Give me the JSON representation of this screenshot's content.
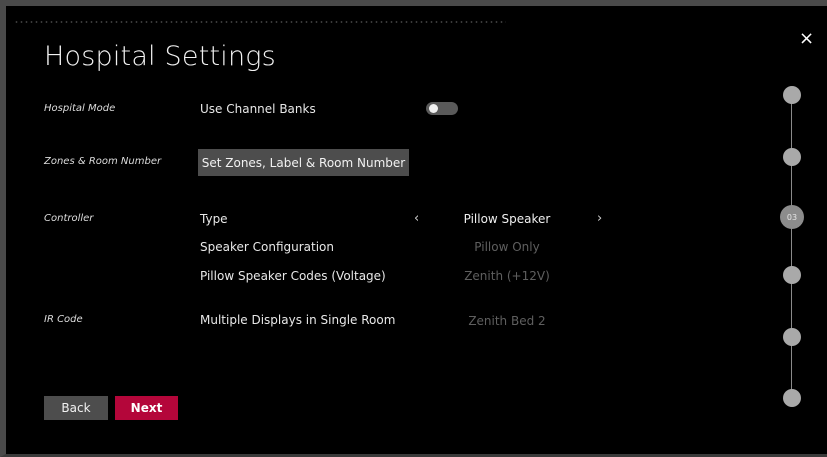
{
  "page": {
    "title": "Hospital Settings",
    "close_glyph": "×"
  },
  "sections": {
    "hospital_mode": {
      "label": "Hospital Mode",
      "use_channel_banks_label": "Use Channel Banks",
      "use_channel_banks_on": false
    },
    "zones": {
      "label": "Zones & Room Number",
      "button_label": "Set Zones, Label & Room Number"
    },
    "controller": {
      "label": "Controller",
      "type_label": "Type",
      "type_value": "Pillow Speaker",
      "prev_glyph": "‹",
      "next_glyph": "›",
      "speaker_config_label": "Speaker Configuration",
      "speaker_config_value": "Pillow Only",
      "pillow_codes_label": "Pillow Speaker Codes (Voltage)",
      "pillow_codes_value": "Zenith (+12V)"
    },
    "ir_code": {
      "label": "IR Code",
      "multiple_displays_label": "Multiple Displays in Single Room",
      "multiple_displays_value": "Zenith Bed 2"
    }
  },
  "footer": {
    "back_label": "Back",
    "next_label": "Next"
  },
  "stepper": {
    "current_label": "03"
  }
}
